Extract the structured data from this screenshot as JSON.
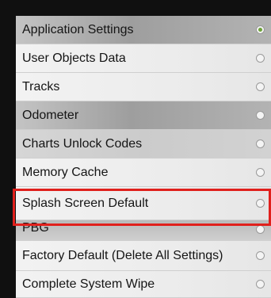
{
  "settings_menu": {
    "items": [
      {
        "label": "Application Settings",
        "selected": true
      },
      {
        "label": "User Objects Data",
        "selected": false
      },
      {
        "label": "Tracks",
        "selected": false
      },
      {
        "label": "Odometer",
        "selected": false
      },
      {
        "label": "Charts Unlock Codes",
        "selected": false
      },
      {
        "label": "Memory Cache",
        "selected": false
      },
      {
        "label": "Splash Screen Default",
        "selected": false,
        "highlighted": true
      },
      {
        "label": "PBG",
        "selected": false
      },
      {
        "label": "Factory Default (Delete All Settings)",
        "selected": false
      },
      {
        "label": "Complete System Wipe",
        "selected": false
      }
    ]
  },
  "colors": {
    "highlight_box": "#e0201c",
    "selected_radio": "#6ea33a"
  }
}
